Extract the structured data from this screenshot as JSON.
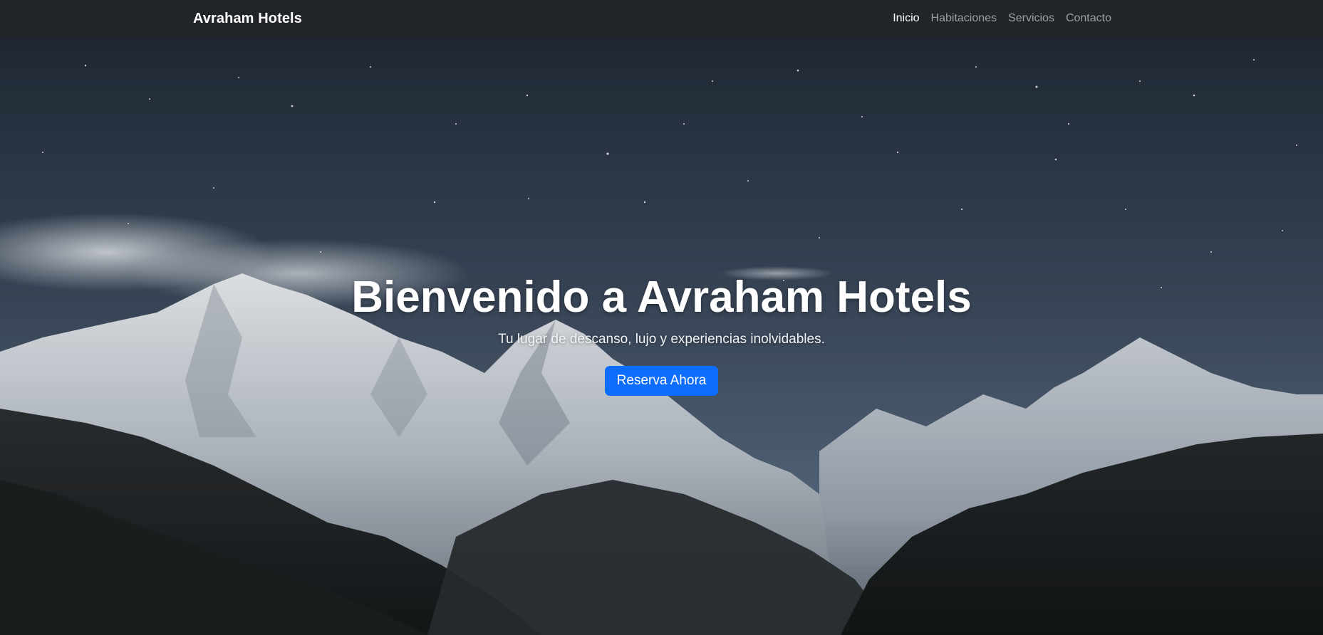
{
  "navbar": {
    "brand": "Avraham Hotels",
    "links": [
      {
        "label": "Inicio",
        "active": true
      },
      {
        "label": "Habitaciones",
        "active": false
      },
      {
        "label": "Servicios",
        "active": false
      },
      {
        "label": "Contacto",
        "active": false
      }
    ]
  },
  "hero": {
    "title": "Bienvenido a Avraham Hotels",
    "subtitle": "Tu lugar de descanso, lujo y experiencias inolvidables.",
    "cta_label": "Reserva Ahora",
    "background_description_icon": "mountain-night-image"
  },
  "colors": {
    "navbar_bg": "#212529",
    "accent": "#0d6efd",
    "sky_top": "#222b38",
    "sky_bottom": "#55677d"
  }
}
